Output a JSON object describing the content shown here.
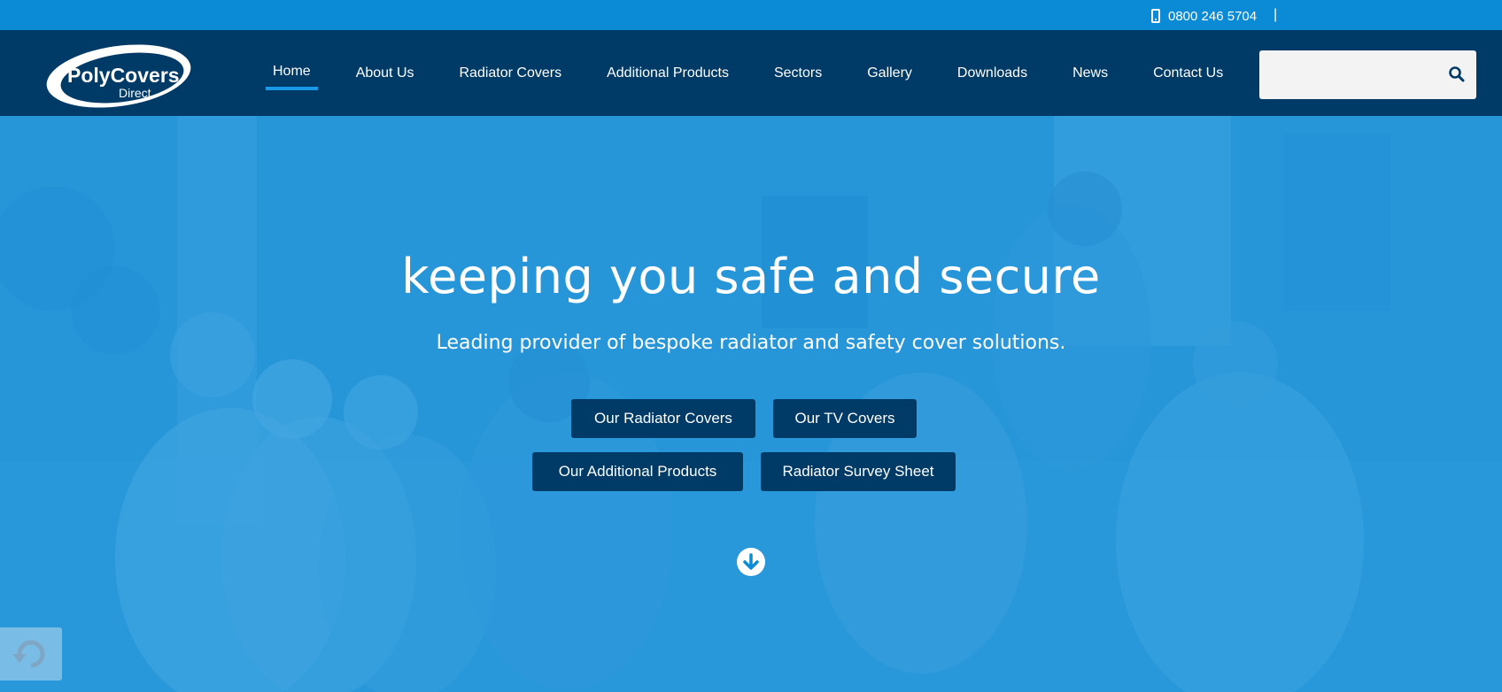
{
  "topbar": {
    "phone_icon": "mobile-phone-icon",
    "phone": "0800 246 5704",
    "separator": "|"
  },
  "header": {
    "logo": {
      "line1": "PolyCovers",
      "line2": "Direct"
    },
    "nav": [
      {
        "label": "Home",
        "active": true
      },
      {
        "label": "About Us"
      },
      {
        "label": "Radiator Covers"
      },
      {
        "label": "Additional Products"
      },
      {
        "label": "Sectors"
      },
      {
        "label": "Gallery"
      },
      {
        "label": "Downloads"
      },
      {
        "label": "News"
      },
      {
        "label": "Contact Us"
      }
    ],
    "search": {
      "placeholder": "",
      "icon": "search-icon"
    }
  },
  "hero": {
    "title": "keeping you safe and secure",
    "subtitle": "Leading provider of bespoke radiator and safety cover solutions.",
    "buttons": [
      {
        "label": "Our Radiator Covers"
      },
      {
        "label": "Our TV Covers"
      },
      {
        "label": "Our Additional Products"
      },
      {
        "label": "Radiator Survey Sheet"
      }
    ],
    "scroll_icon": "arrow-down-circle-icon"
  },
  "colors": {
    "topbar": "#0b8bd6",
    "header": "#003a66",
    "accent": "#1a9ae6",
    "hero_tint": "#148cd7",
    "button": "#003a66"
  }
}
